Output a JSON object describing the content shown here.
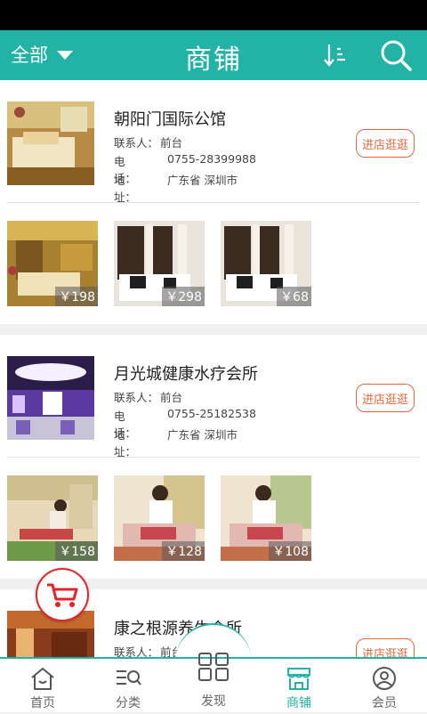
{
  "header": {
    "filter_label": "全部",
    "title": "商铺",
    "bg_color": "#22b3a6"
  },
  "shops": [
    {
      "name": "朝阳门国际公馆",
      "contact_key": "联系人：",
      "contact_val": "前台",
      "phone_key": "电　　话：",
      "phone_val": "0755-28399988",
      "address_key": "地　　址：",
      "address_val": "广东省 深圳市",
      "visit_label": "进店逛逛",
      "products": [
        {
          "price": "￥198"
        },
        {
          "price": "￥298"
        },
        {
          "price": "￥68"
        }
      ]
    },
    {
      "name": "月光城健康水疗会所",
      "contact_key": "联系人：",
      "contact_val": "前台",
      "phone_key": "电　　话：",
      "phone_val": "0755-25182538",
      "address_key": "地　　址：",
      "address_val": "广东省 深圳市",
      "visit_label": "进店逛逛",
      "products": [
        {
          "price": "￥158"
        },
        {
          "price": "￥128"
        },
        {
          "price": "￥108"
        }
      ]
    },
    {
      "name": "康之根源养生会所",
      "contact_key": "联系人：",
      "contact_val": "前台",
      "visit_label": "进店逛逛"
    }
  ],
  "tabs": {
    "home": "首页",
    "category": "分类",
    "discover": "发现",
    "shops": "商铺",
    "member": "会员"
  }
}
